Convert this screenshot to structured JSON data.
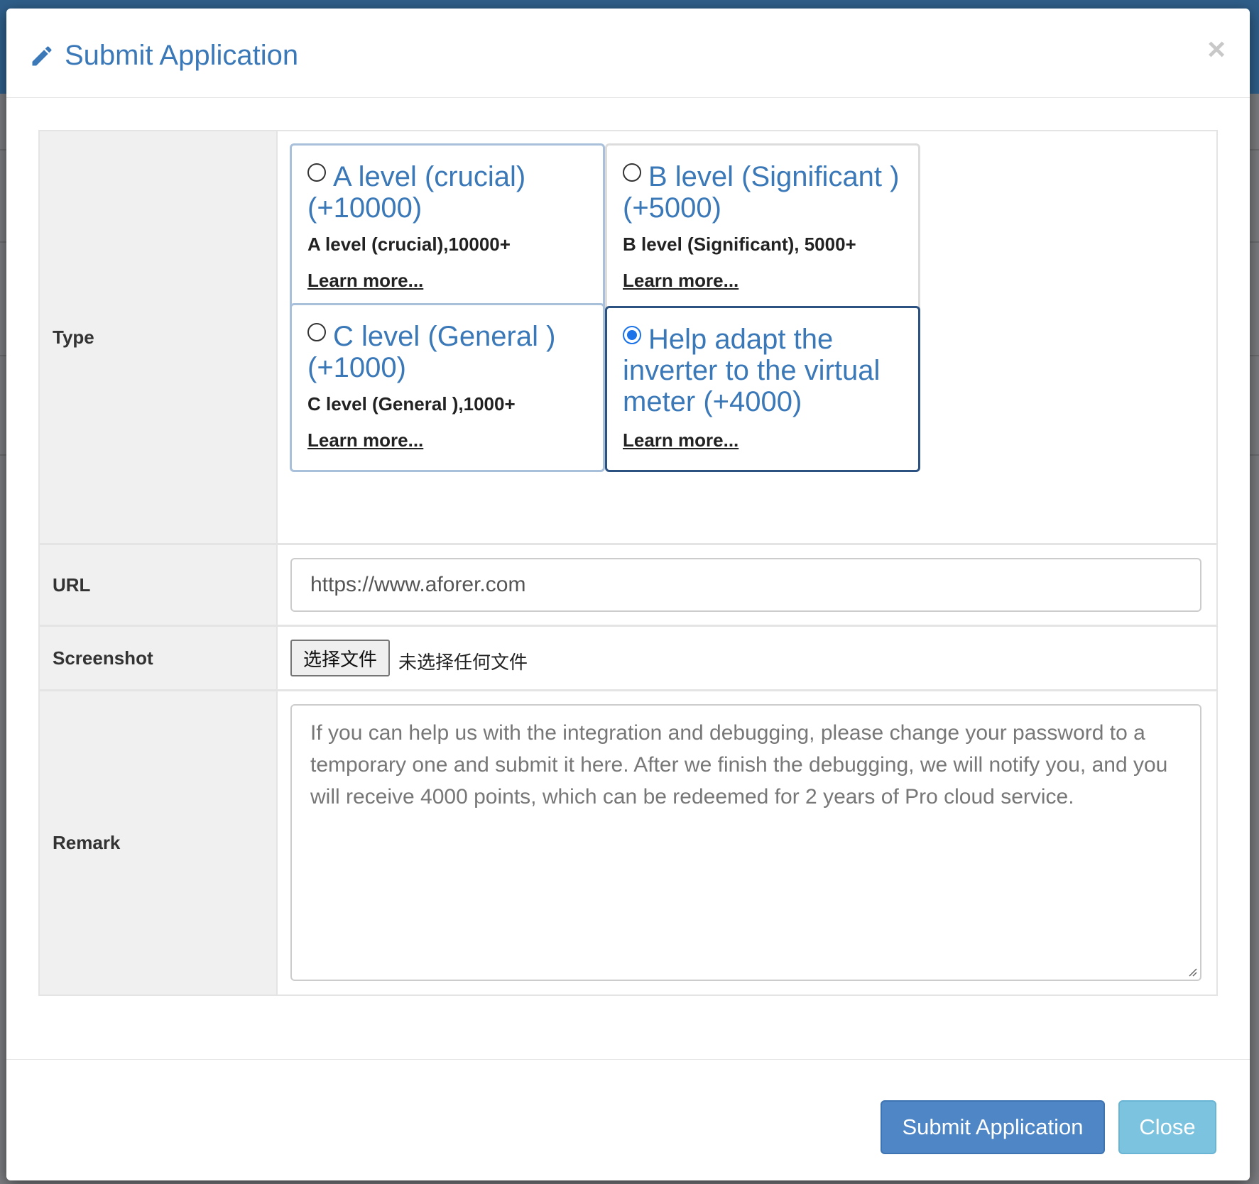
{
  "modal": {
    "title": "Submit Application",
    "close_symbol": "×",
    "title_icon": "pencil-icon"
  },
  "form": {
    "type_label": "Type",
    "url_label": "URL",
    "screenshot_label": "Screenshot",
    "remark_label": "Remark",
    "options": [
      {
        "title": "A level (crucial) (+10000)",
        "desc": "A level (crucial),10000+",
        "link": "Learn more...",
        "selected": false
      },
      {
        "title": "B level (Significant ) (+5000)",
        "desc": "B level (Significant), 5000+",
        "link": "Learn more...",
        "selected": false
      },
      {
        "title": "C level (General ) (+1000)",
        "desc": "C level (General ),1000+",
        "link": "Learn more...",
        "selected": false
      },
      {
        "title": "Help adapt the inverter to the virtual meter (+4000)",
        "desc": "",
        "link": "Learn more...",
        "selected": true
      }
    ],
    "url_value": "https://www.aforer.com",
    "file_button": "选择文件",
    "file_status": "未选择任何文件",
    "remark_placeholder": "If you can help us with the integration and debugging, please change your password to a temporary one and submit it here. After we finish the debugging, we will notify you, and you will receive 4000 points, which can be redeemed for 2 years of Pro cloud service."
  },
  "footer": {
    "submit_label": "Submit Application",
    "close_label": "Close"
  },
  "colors": {
    "accent": "#3a78b8",
    "primary_button": "#4f86c6",
    "info_button": "#7cc3df",
    "selected_border": "#2c5282"
  }
}
